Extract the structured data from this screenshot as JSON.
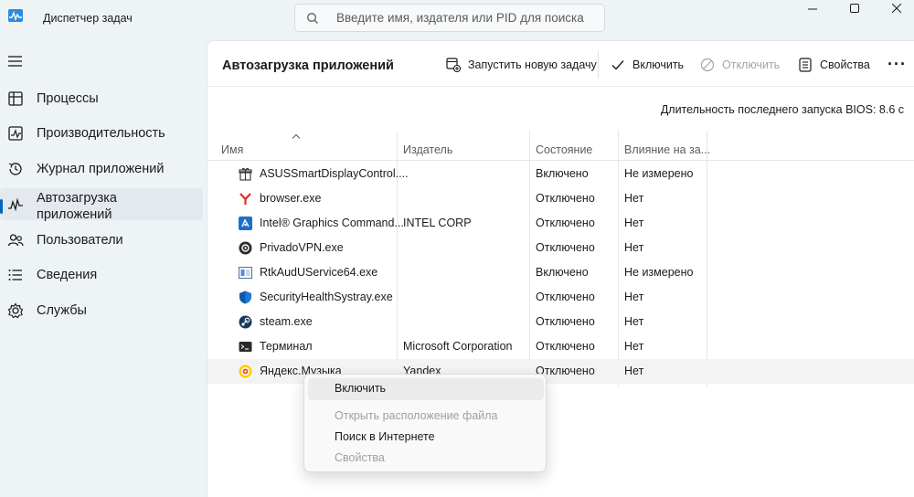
{
  "app": {
    "title": "Диспетчер задач",
    "icon": "task-manager-icon"
  },
  "search": {
    "placeholder": "Введите имя, издателя или PID для поиска"
  },
  "window_controls": [
    "minimize",
    "maximize",
    "close"
  ],
  "sidebar": {
    "items": [
      {
        "label": "Процессы",
        "icon": "processes-icon",
        "active": false
      },
      {
        "label": "Производительность",
        "icon": "performance-icon",
        "active": false
      },
      {
        "label": "Журнал приложений",
        "icon": "app-history-icon",
        "active": false
      },
      {
        "label": "Автозагрузка\nприложений",
        "icon": "startup-apps-icon",
        "active": true
      },
      {
        "label": "Пользователи",
        "icon": "users-icon",
        "active": false
      },
      {
        "label": "Сведения",
        "icon": "details-icon",
        "active": false
      },
      {
        "label": "Службы",
        "icon": "services-icon",
        "active": false
      }
    ]
  },
  "main": {
    "title": "Автозагрузка приложений",
    "toolbar": {
      "run_new_task": "Запустить новую задачу",
      "enable": "Включить",
      "disable": "Отключить",
      "properties": "Свойства"
    },
    "bios_label": "Длительность последнего запуска BIOS: 8.6 с",
    "table": {
      "columns": [
        "Имя",
        "Издатель",
        "Состояние",
        "Влияние на за..."
      ],
      "rows": [
        {
          "name": "ASUSSmartDisplayControl....",
          "publisher": "",
          "state": "Включено",
          "impact": "Не измерено",
          "icon": "gift-box-icon"
        },
        {
          "name": "browser.exe",
          "publisher": "",
          "state": "Отключено",
          "impact": "Нет",
          "icon": "yandex-browser-icon"
        },
        {
          "name": "Intel® Graphics Command...",
          "publisher": "INTEL CORP",
          "state": "Отключено",
          "impact": "Нет",
          "icon": "intel-graphics-icon"
        },
        {
          "name": "PrivadoVPN.exe",
          "publisher": "",
          "state": "Отключено",
          "impact": "Нет",
          "icon": "privadovpn-icon"
        },
        {
          "name": "RtkAudUService64.exe",
          "publisher": "",
          "state": "Включено",
          "impact": "Не измерено",
          "icon": "realtek-audio-icon"
        },
        {
          "name": "SecurityHealthSystray.exe",
          "publisher": "",
          "state": "Отключено",
          "impact": "Нет",
          "icon": "security-shield-icon"
        },
        {
          "name": "steam.exe",
          "publisher": "",
          "state": "Отключено",
          "impact": "Нет",
          "icon": "steam-icon"
        },
        {
          "name": "Терминал",
          "publisher": "Microsoft Corporation",
          "state": "Отключено",
          "impact": "Нет",
          "icon": "terminal-icon"
        },
        {
          "name": "Яндекс.Музыка",
          "publisher": "Yandex",
          "state": "Отключено",
          "impact": "Нет",
          "icon": "yandex-music-icon"
        }
      ]
    }
  },
  "context_menu": {
    "items": [
      {
        "label": "Включить",
        "disabled": false,
        "highlighted": true
      },
      {
        "label": "Открыть расположение файла",
        "disabled": true,
        "highlighted": false
      },
      {
        "label": "Поиск в Интернете",
        "disabled": false,
        "highlighted": false
      },
      {
        "label": "Свойства",
        "disabled": true,
        "highlighted": false
      }
    ]
  },
  "colors": {
    "accent": "#0067c0",
    "window_bg": "#eef3f6",
    "panel_bg": "#ffffff"
  }
}
